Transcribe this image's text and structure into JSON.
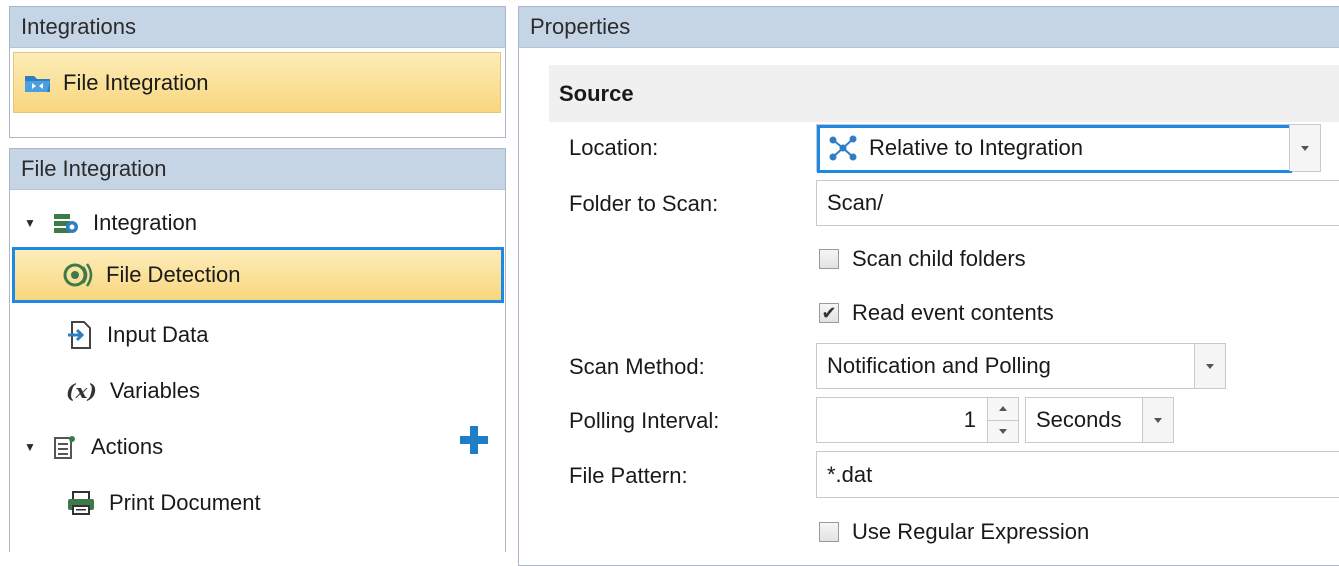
{
  "integrations_panel": {
    "title": "Integrations",
    "item_label": "File Integration"
  },
  "tree_panel": {
    "title": "File Integration",
    "items": [
      {
        "label": "Integration"
      },
      {
        "label": "File Detection"
      },
      {
        "label": "Input Data"
      },
      {
        "label": "Variables"
      },
      {
        "label": "Actions"
      },
      {
        "label": "Print Document"
      }
    ],
    "variables_icon_text": "(x)"
  },
  "properties_panel": {
    "title": "Properties",
    "section_title": "Source",
    "location": {
      "label": "Location:",
      "value": "Relative to Integration"
    },
    "folder": {
      "label": "Folder to Scan:",
      "value": "Scan/"
    },
    "scan_child": {
      "label": "Scan child folders",
      "checked": false
    },
    "read_contents": {
      "label": "Read event contents",
      "checked": true,
      "check_glyph": "✔"
    },
    "scan_method": {
      "label": "Scan Method:",
      "value": "Notification and Polling"
    },
    "polling": {
      "label": "Polling Interval:",
      "value": "1",
      "unit": "Seconds"
    },
    "pattern": {
      "label": "File Pattern:",
      "value": "*.dat"
    },
    "use_regex": {
      "label": "Use Regular Expression",
      "checked": false
    }
  },
  "colors": {
    "header_bg": "#c6d5e6",
    "selection_bg": "#f8d67e",
    "focus_border": "#1e88e5",
    "accent_plus": "#1e7fc9"
  }
}
